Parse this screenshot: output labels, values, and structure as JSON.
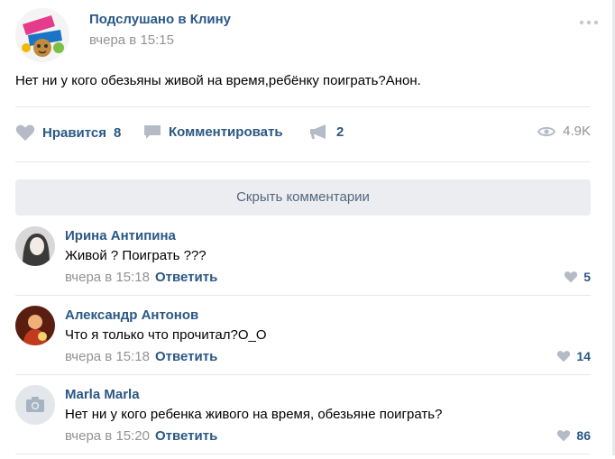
{
  "post": {
    "author": "Подслушано в Клину",
    "time": "вчера в 15:15",
    "text": "Нет ни у кого обезьяны живой на время,ребёнку поиграть?Анон.",
    "avatar_caption": "ПОДСЛУШАНО В КЛИНУ"
  },
  "actions": {
    "like_label": "Нравится",
    "like_count": "8",
    "comment_label": "Комментировать",
    "share_count": "2",
    "views": "4.9K"
  },
  "comments_toggle": {
    "label": "Скрыть комментарии"
  },
  "comments": [
    {
      "author": "Ирина Антипина",
      "text": "Живой ? Поиграть ???",
      "time": "вчера в 15:18",
      "reply": "Ответить",
      "likes": "5"
    },
    {
      "author": "Александр Антонов",
      "text": "Что я только что прочитал?О_О",
      "time": "вчера в 15:18",
      "reply": "Ответить",
      "likes": "14"
    },
    {
      "author": "Marla Marla",
      "text": "Нет ни у кого ребенка живого на время, обезьяне поиграть?",
      "time": "вчера в 15:20",
      "reply": "Ответить",
      "likes": "86"
    }
  ],
  "colors": {
    "link": "#2a5885",
    "meta": "#939393",
    "separator": "#e7e8ec",
    "button_bg": "#ebedf0"
  },
  "icons": [
    "heart-icon",
    "comment-icon",
    "share-megaphone-icon",
    "eye-icon",
    "more-dots-icon",
    "camera-placeholder-icon"
  ]
}
